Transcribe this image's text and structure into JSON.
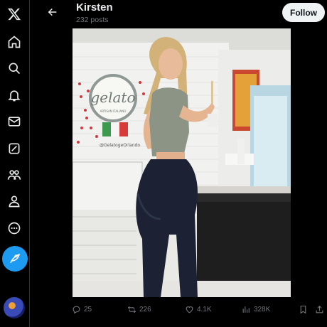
{
  "profile": {
    "name": "Kirsten",
    "posts_count": "232 posts"
  },
  "header": {
    "follow_label": "Follow"
  },
  "nav": {
    "items": [
      "x-logo",
      "home-icon",
      "explore-icon",
      "notifications-icon",
      "messages-icon",
      "grok-icon",
      "communities-icon",
      "profile-icon",
      "more-icon"
    ],
    "compose_icon": "compose-icon"
  },
  "photo": {
    "sign_text": "gelato",
    "sign_subtext": "ARTISAN ITALIANO",
    "handle_text": "@GelatogeOrlando"
  },
  "actions": {
    "replies": "25",
    "reposts": "226",
    "likes": "4.1K",
    "views": "328K"
  },
  "colors": {
    "accent": "#1d9bf0",
    "background": "#000000",
    "muted": "#71767b",
    "text": "#e7e9ea"
  }
}
